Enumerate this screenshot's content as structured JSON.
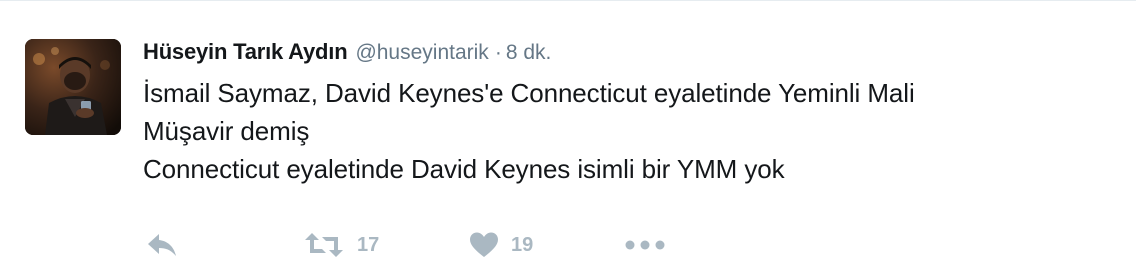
{
  "tweet": {
    "fullname": "Hüseyin Tarık Aydın",
    "username": "@huseyintarik",
    "separator": "·",
    "time": "8 dk.",
    "text_lines": [
      "İsmail Saymaz, David Keynes'e Connecticut eyaletinde Yeminli Mali",
      "Müşavir demiş",
      "Connecticut eyaletinde David Keynes isimli bir YMM yok"
    ],
    "retweet_count": "17",
    "like_count": "19"
  },
  "icons": {
    "reply": "reply-icon",
    "retweet": "retweet-icon",
    "like": "heart-icon",
    "more": "more-icon"
  },
  "colors": {
    "text": "#14171a",
    "secondary": "#657786",
    "action": "#aab8c2",
    "border": "#e6ecf0"
  }
}
